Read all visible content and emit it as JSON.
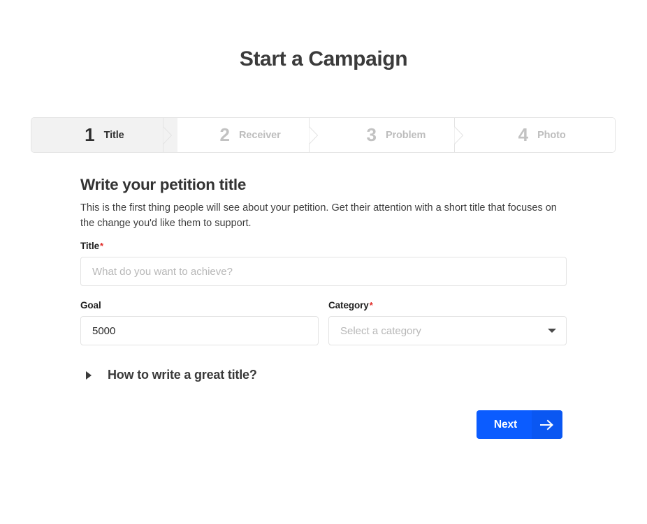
{
  "page": {
    "title": "Start a Campaign"
  },
  "stepper": {
    "steps": [
      {
        "number": "1",
        "label": "Title",
        "active": true
      },
      {
        "number": "2",
        "label": "Receiver",
        "active": false
      },
      {
        "number": "3",
        "label": "Problem",
        "active": false
      },
      {
        "number": "4",
        "label": "Photo",
        "active": false
      }
    ]
  },
  "form": {
    "heading": "Write your petition title",
    "description": "This is the first thing people will see about your petition. Get their attention with a short title that focuses on the change you'd like them to support.",
    "title_field": {
      "label": "Title",
      "required_marker": "*",
      "value": "",
      "placeholder": "What do you want to achieve?"
    },
    "goal_field": {
      "label": "Goal",
      "value": "5000",
      "placeholder": ""
    },
    "category_field": {
      "label": "Category",
      "required_marker": "*",
      "selected": "Select a category"
    },
    "accordion": {
      "label": "How to write a great title?",
      "marker_icon": "triangle-right-icon",
      "expanded": false
    },
    "next_button": {
      "label": "Next",
      "arrow_icon": "arrow-right-icon"
    }
  },
  "colors": {
    "accent": "#0b5cff",
    "accent_dark": "#0a57f2",
    "required": "#e02b27",
    "active_step_bg": "#f2f2f2",
    "border": "#e3e3e3",
    "text_dark": "#333333",
    "text_muted": "#bdbdbd"
  }
}
